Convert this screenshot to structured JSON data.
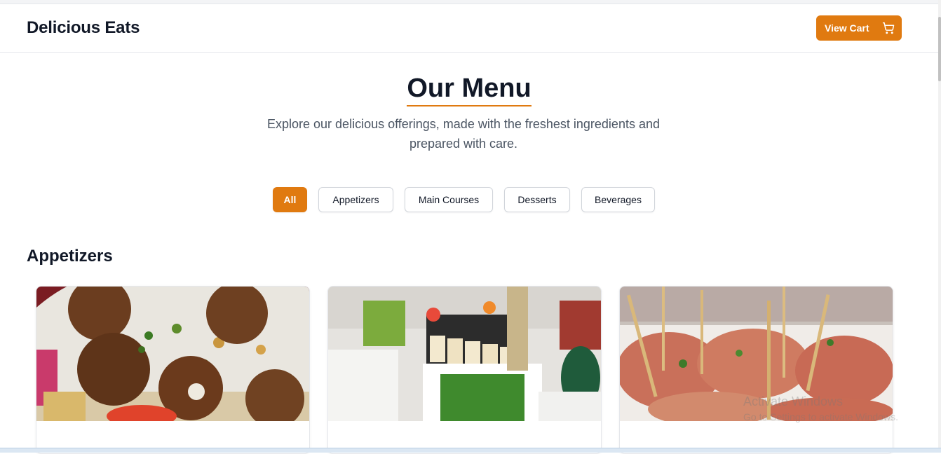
{
  "header": {
    "brand": "Delicious Eats",
    "cart_label": "View Cart",
    "cart_icon": "shopping-cart-icon"
  },
  "hero": {
    "title": "Our Menu",
    "subtitle": "Explore our delicious offerings, made with the freshest ingredients and prepared with care."
  },
  "filters": [
    {
      "label": "All",
      "active": true
    },
    {
      "label": "Appetizers",
      "active": false
    },
    {
      "label": "Main Courses",
      "active": false
    },
    {
      "label": "Desserts",
      "active": false
    },
    {
      "label": "Beverages",
      "active": false
    }
  ],
  "section": {
    "title": "Appetizers"
  },
  "cards": [
    {
      "image": "falafel-plate-photo"
    },
    {
      "image": "sushi-canape-display-photo"
    },
    {
      "image": "skewered-appetizer-bites-photo"
    }
  ],
  "watermark": {
    "line1": "Activate Windows",
    "line2": "Go to Settings to activate Windows."
  },
  "colors": {
    "accent": "#e07a10",
    "heading": "#111827",
    "body_text": "#4b5563"
  }
}
